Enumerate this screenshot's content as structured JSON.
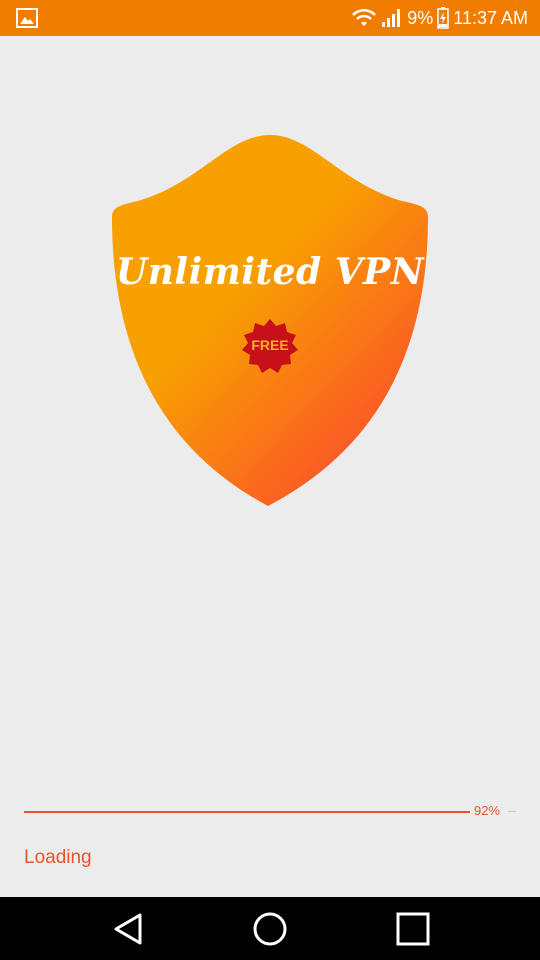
{
  "status_bar": {
    "battery_percent": "9%",
    "time": "11:37 AM",
    "color": "#f07d00",
    "icons": [
      "image-notification-icon",
      "wifi-icon",
      "signal-icon",
      "battery-charging-icon"
    ]
  },
  "splash": {
    "title": "Unlimited VPN",
    "badge": "FREE",
    "shield_colors": [
      "#f7a400",
      "#fb5a28"
    ],
    "badge_color": "#c8101b"
  },
  "progress": {
    "value": 92,
    "label": "92%",
    "color": "#e8552b"
  },
  "status_text": "Loading",
  "nav_bar": {
    "buttons": [
      "back-icon",
      "home-icon",
      "recents-icon"
    ]
  }
}
